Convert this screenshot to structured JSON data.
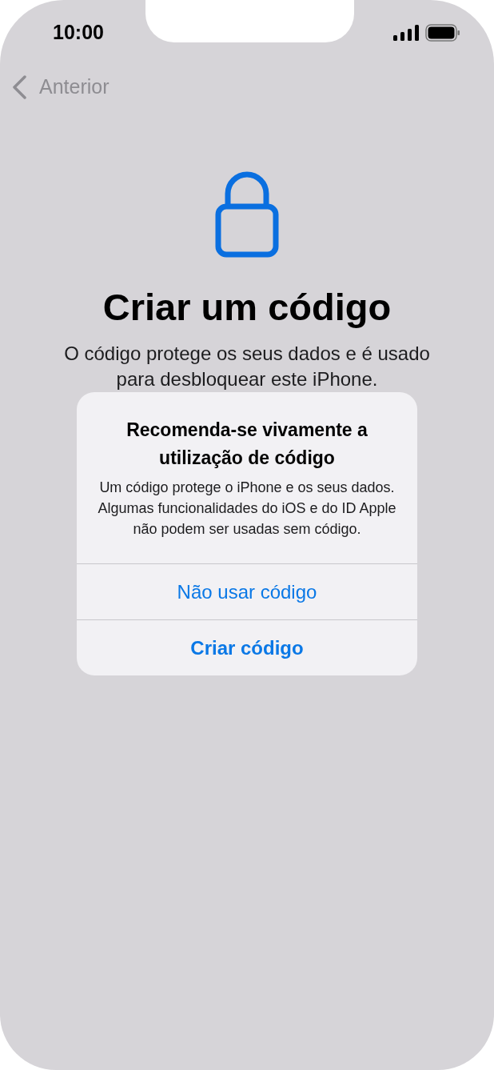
{
  "status_bar": {
    "time": "10:00"
  },
  "nav": {
    "back_label": "Anterior"
  },
  "title": "Criar um código",
  "description_lines": [
    "O código protege os seus dados e é usado",
    "para desbloquear este iPhone."
  ],
  "alert": {
    "title": "Recomenda-se vivamente a utilização de código",
    "message": "Um código protege o iPhone e os seus dados. Algumas funcionalidades do iOS e do ID Apple não podem ser usadas sem código.",
    "actions": [
      {
        "label": "Não usar código",
        "kind": "default"
      },
      {
        "label": "Criar código",
        "kind": "preferred"
      }
    ]
  }
}
